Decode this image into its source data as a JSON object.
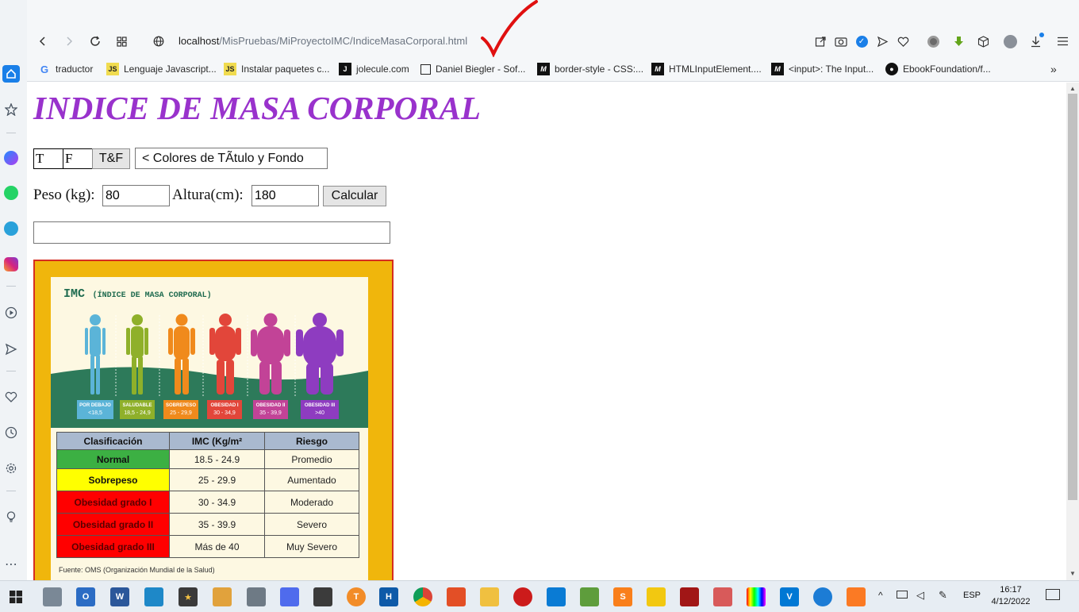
{
  "browser": {
    "url_host": "localhost",
    "url_path": "/MisPruebas/MiProyectoIMC/IndiceMasaCorporal.html"
  },
  "bookmarks": [
    {
      "label": "traductor",
      "icon": "google-icon"
    },
    {
      "label": "Lenguaje Javascript...",
      "icon": "js-icon"
    },
    {
      "label": "Instalar paquetes c...",
      "icon": "js-icon"
    },
    {
      "label": "jolecule.com",
      "icon": "j-icon"
    },
    {
      "label": "Daniel Biegler - Sof...",
      "icon": "page-icon"
    },
    {
      "label": "border-style - CSS:...",
      "icon": "mdn-icon"
    },
    {
      "label": "HTMLInputElement....",
      "icon": "mdn-icon"
    },
    {
      "label": "<input>: The Input...",
      "icon": "mdn-icon"
    },
    {
      "label": "EbookFoundation/f...",
      "icon": "github-icon"
    }
  ],
  "page": {
    "title": "INDICE DE MASA CORPORAL",
    "title_color": "#9932cc",
    "title_input_value": "T",
    "background_input_value": "F",
    "apply_button": "T&F",
    "colors_button": "< Colores de TÃtulo y Fondo",
    "weight_label": "Peso (kg):",
    "weight_value": "80",
    "height_label": "Altura(cm):",
    "height_value": "180",
    "calculate_button": "Calcular",
    "result_value": ""
  },
  "bmi_image": {
    "heading": "IMC",
    "subheading": "(ÍNDICE DE MASA CORPORAL)",
    "categories": [
      {
        "name": "POR DEBAJO",
        "range": "<18,5",
        "color": "#5bb4d8"
      },
      {
        "name": "SALUDABLE",
        "range": "18,5 - 24,9",
        "color": "#8fb02a"
      },
      {
        "name": "SOBREPESO",
        "range": "25 - 29,9",
        "color": "#f08a1c"
      },
      {
        "name": "OBESIDAD I",
        "range": "30 - 34,9",
        "color": "#e2463a"
      },
      {
        "name": "OBESIDAD II",
        "range": "35 - 39,9",
        "color": "#c24397"
      },
      {
        "name": "OBESIDAD III",
        "range": ">40",
        "color": "#8e3cc0"
      }
    ],
    "table_headers": [
      "Clasificación",
      "IMC (Kg/m²",
      "Riesgo"
    ],
    "table_rows": [
      {
        "clasificacion": "Normal",
        "imc": "18.5 - 24.9",
        "riesgo": "Promedio",
        "color": "#3cb043",
        "text_color": "#111111"
      },
      {
        "clasificacion": "Sobrepeso",
        "imc": "25 - 29.9",
        "riesgo": "Aumentado",
        "color": "#ffff00",
        "text_color": "#111111"
      },
      {
        "clasificacion": "Obesidad grado I",
        "imc": "30 - 34.9",
        "riesgo": "Moderado",
        "color": "#ff0000",
        "text_color": "#5a0000"
      },
      {
        "clasificacion": "Obesidad grado II",
        "imc": "35 - 39.9",
        "riesgo": "Severo",
        "color": "#ff0000",
        "text_color": "#5a0000"
      },
      {
        "clasificacion": "Obesidad grado III",
        "imc": "Más de 40",
        "riesgo": "Muy Severo",
        "color": "#ff0000",
        "text_color": "#5a0000"
      }
    ],
    "source": "Fuente: OMS (Organización Mundial de la Salud)"
  },
  "taskbar": {
    "language": "ESP",
    "time": "16:17",
    "date": "4/12/2022"
  }
}
